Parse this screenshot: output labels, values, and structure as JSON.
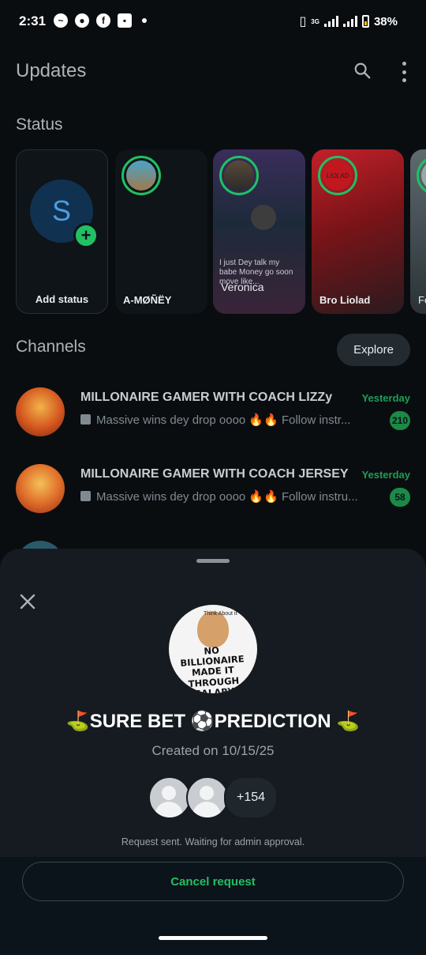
{
  "statusbar": {
    "time": "2:31",
    "battery": "38%",
    "network": "3G",
    "notification_icons": [
      "messenger-icon",
      "chat-bubble-icon",
      "facebook-icon",
      "app-icon"
    ]
  },
  "header": {
    "title": "Updates"
  },
  "status_section": {
    "title": "Status",
    "add": {
      "initial": "S",
      "label": "Add status"
    },
    "cards": [
      {
        "label": "A-MØÑËY"
      },
      {
        "label": "Veronica",
        "overlay": "I just Dey talk my babe Money go soon move like..."
      },
      {
        "label": "Bro Liolad",
        "overlay": "LIOLAD"
      },
      {
        "label": "Fe"
      }
    ]
  },
  "channels_section": {
    "title": "Channels",
    "explore_label": "Explore",
    "items": [
      {
        "name": "MILLONAIRE GAMER WITH COACH LIZZy",
        "preview": "Massive wins dey drop oooo 🔥🔥  Follow instr...",
        "time": "Yesterday",
        "badge": "210"
      },
      {
        "name": "MILLONAIRE GAMER WITH COACH JERSEY",
        "preview": "Massive wins dey drop oooo 🔥🔥  Follow instru...",
        "time": "Yesterday",
        "badge": "58"
      }
    ]
  },
  "sheet": {
    "avatar_text": "NO BILLIONAIRE MADE IT THROUGH SALARY",
    "avatar_bubble": "Think About it",
    "title": "⛳SURE BET ⚽PREDICTION ⛳",
    "created": "Created on 10/15/25",
    "member_count": "+154",
    "note": "Request sent. Waiting for admin approval.",
    "cancel_label": "Cancel request"
  },
  "colors": {
    "accent": "#21c063",
    "background": "#0b141a",
    "sheet": "#151b20"
  }
}
